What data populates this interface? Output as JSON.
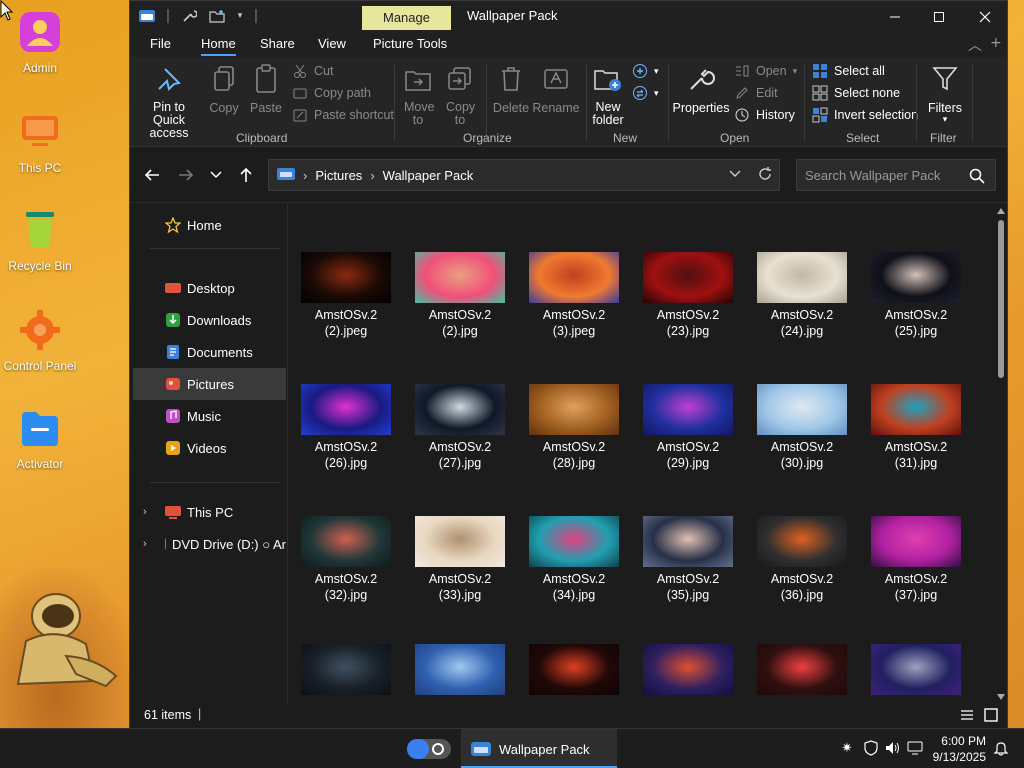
{
  "desktop": {
    "icons": [
      {
        "label": "Admin",
        "icon": "user-icon",
        "color": "#d63fd8"
      },
      {
        "label": "This PC",
        "icon": "monitor-icon",
        "color": "#f26b1d"
      },
      {
        "label": "Recycle Bin",
        "icon": "recycle-bin-icon",
        "color": "#7cc83a"
      },
      {
        "label": "Control Panel",
        "icon": "gear-icon",
        "color": "#f26b1d"
      },
      {
        "label": "Activator",
        "icon": "folder-icon",
        "color": "#2d8cf0"
      }
    ]
  },
  "window": {
    "title": "Wallpaper Pack",
    "manage_tab": "Manage",
    "menu": [
      "File",
      "Home",
      "Share",
      "View",
      "Picture Tools"
    ],
    "active_menu": "Home",
    "ribbon": {
      "clipboard": {
        "group": "Clipboard",
        "pin": "Pin to Quick access",
        "copy": "Copy",
        "paste": "Paste",
        "cut": "Cut",
        "copy_path": "Copy path",
        "paste_shortcut": "Paste shortcut"
      },
      "organize": {
        "group": "Organize",
        "move_to": "Move to",
        "copy_to": "Copy to",
        "delete": "Delete",
        "rename": "Rename"
      },
      "new": {
        "group": "New",
        "new_folder": "New folder"
      },
      "open": {
        "group": "Open",
        "properties": "Properties",
        "open": "Open",
        "edit": "Edit",
        "history": "History"
      },
      "select": {
        "group": "Select",
        "select_all": "Select all",
        "select_none": "Select none",
        "invert": "Invert selection"
      },
      "filter": {
        "group": "Filter",
        "filters": "Filters"
      }
    },
    "address": {
      "crumbs": [
        "Pictures",
        "Wallpaper Pack"
      ]
    },
    "search": {
      "placeholder": "Search Wallpaper Pack"
    },
    "sidebar": {
      "items": [
        {
          "label": "Home",
          "icon": "star-icon"
        },
        {
          "label": "Desktop",
          "icon": "desktop-icon"
        },
        {
          "label": "Downloads",
          "icon": "downloads-icon"
        },
        {
          "label": "Documents",
          "icon": "documents-icon"
        },
        {
          "label": "Pictures",
          "icon": "pictures-icon"
        },
        {
          "label": "Music",
          "icon": "music-icon"
        },
        {
          "label": "Videos",
          "icon": "videos-icon"
        },
        {
          "label": "This PC",
          "icon": "pc-icon"
        },
        {
          "label": "DVD Drive (D:) ○ Ar",
          "icon": "dvd-icon"
        }
      ],
      "selected": "Pictures"
    },
    "files": [
      {
        "name": "AmstOSv.2 (2).jpeg",
        "l1": "AmstOSv.2",
        "l2": "(2).jpeg",
        "colors": [
          "#1a0a05",
          "#8a2a10",
          "#000"
        ]
      },
      {
        "name": "AmstOSv.2 (2).jpg",
        "l1": "AmstOSv.2",
        "l2": "(2).jpg",
        "colors": [
          "#f0507a",
          "#e8a080",
          "#40c0a0"
        ]
      },
      {
        "name": "AmstOSv.2 (3).jpeg",
        "l1": "AmstOSv.2",
        "l2": "(3).jpeg",
        "colors": [
          "#f07a30",
          "#c04020",
          "#3a3aa0"
        ]
      },
      {
        "name": "AmstOSv.2 (23).jpg",
        "l1": "AmstOSv.2",
        "l2": "(23).jpg",
        "colors": [
          "#a01010",
          "#501010",
          "#200505"
        ]
      },
      {
        "name": "AmstOSv.2 (24).jpg",
        "l1": "AmstOSv.2",
        "l2": "(24).jpg",
        "colors": [
          "#e8e0d0",
          "#c0b8a8",
          "#a8a090"
        ]
      },
      {
        "name": "AmstOSv.2 (25).jpg",
        "l1": "AmstOSv.2",
        "l2": "(25).jpg",
        "colors": [
          "#101018",
          "#d0c0b8",
          "#202030"
        ]
      },
      {
        "name": "AmstOSv.2 (26).jpg",
        "l1": "AmstOSv.2",
        "l2": "(26).jpg",
        "colors": [
          "#1a1a80",
          "#e030d0",
          "#2040d0"
        ]
      },
      {
        "name": "AmstOSv.2 (27).jpg",
        "l1": "AmstOSv.2",
        "l2": "(27).jpg",
        "colors": [
          "#101828",
          "#d0d8e0",
          "#303848"
        ]
      },
      {
        "name": "AmstOSv.2 (28).jpg",
        "l1": "AmstOSv.2",
        "l2": "(28).jpg",
        "colors": [
          "#a06020",
          "#e0a060",
          "#603010"
        ]
      },
      {
        "name": "AmstOSv.2 (29).jpg",
        "l1": "AmstOSv.2",
        "l2": "(29).jpg",
        "colors": [
          "#2030a0",
          "#c040d0",
          "#101860"
        ]
      },
      {
        "name": "AmstOSv.2 (30).jpg",
        "l1": "AmstOSv.2",
        "l2": "(30).jpg",
        "colors": [
          "#a0c8e8",
          "#e0e8f0",
          "#6090c0"
        ]
      },
      {
        "name": "AmstOSv.2 (31).jpg",
        "l1": "AmstOSv.2",
        "l2": "(31).jpg",
        "colors": [
          "#c04020",
          "#20a0c0",
          "#601010"
        ]
      },
      {
        "name": "AmstOSv.2 (32).jpg",
        "l1": "AmstOSv.2",
        "l2": "(32).jpg",
        "colors": [
          "#203838",
          "#d06050",
          "#101818"
        ]
      },
      {
        "name": "AmstOSv.2 (33).jpg",
        "l1": "AmstOSv.2",
        "l2": "(33).jpg",
        "colors": [
          "#e8d8c0",
          "#b09070",
          "#f0e8e0"
        ]
      },
      {
        "name": "AmstOSv.2 (34).jpg",
        "l1": "AmstOSv.2",
        "l2": "(34).jpg",
        "colors": [
          "#20a0b0",
          "#e04080",
          "#104050"
        ]
      },
      {
        "name": "AmstOSv.2 (35).jpg",
        "l1": "AmstOSv.2",
        "l2": "(35).jpg",
        "colors": [
          "#283048",
          "#e0c0b0",
          "#607090"
        ]
      },
      {
        "name": "AmstOSv.2 (36).jpg",
        "l1": "AmstOSv.2",
        "l2": "(36).jpg",
        "colors": [
          "#303030",
          "#e06020",
          "#181818"
        ]
      },
      {
        "name": "AmstOSv.2 (37).jpg",
        "l1": "AmstOSv.2",
        "l2": "(37).jpg",
        "colors": [
          "#b020a0",
          "#e040b0",
          "#301040"
        ]
      },
      {
        "name": "",
        "l1": "",
        "l2": "",
        "colors": [
          "#182028",
          "#405060",
          "#0c1014"
        ]
      },
      {
        "name": "",
        "l1": "",
        "l2": "",
        "colors": [
          "#3060b0",
          "#a0c8f0",
          "#204080"
        ]
      },
      {
        "name": "",
        "l1": "",
        "l2": "",
        "colors": [
          "#200808",
          "#e04020",
          "#100404"
        ]
      },
      {
        "name": "",
        "l1": "",
        "l2": "",
        "colors": [
          "#302060",
          "#e05030",
          "#101040"
        ]
      },
      {
        "name": "",
        "l1": "",
        "l2": "",
        "colors": [
          "#301010",
          "#f04040",
          "#200808"
        ]
      },
      {
        "name": "",
        "l1": "",
        "l2": "",
        "colors": [
          "#202060",
          "#a0a0c0",
          "#402080"
        ]
      }
    ],
    "status": {
      "items": "61 items"
    }
  },
  "taskbar": {
    "app_label": "Wallpaper Pack",
    "time": "6:00 PM",
    "date": "9/13/2025"
  },
  "colors": {
    "accent": "#4aa3ff",
    "manage_tab": "#e7e69b",
    "desktop_bg": "#f2b33a"
  }
}
